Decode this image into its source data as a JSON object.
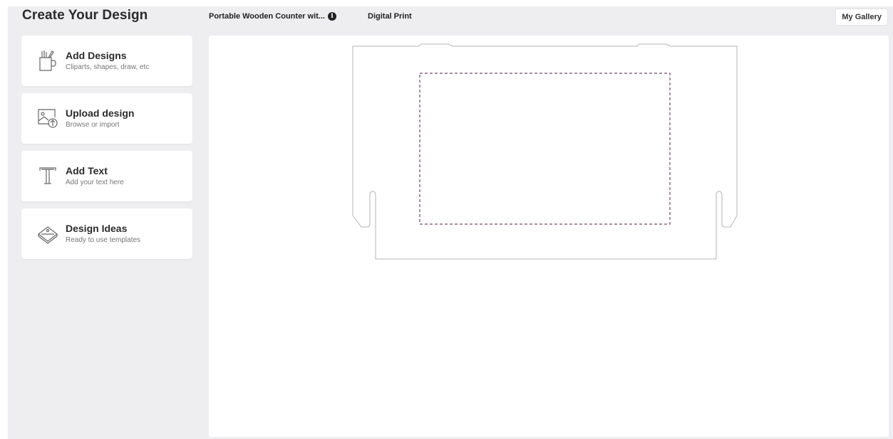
{
  "header": {
    "title": "Create Your Design",
    "product_name": "Portable Wooden Counter wit...",
    "info_icon_glyph": "i",
    "print_type": "Digital Print",
    "gallery_button": "My Gallery"
  },
  "tools": [
    {
      "title": "Add Designs",
      "subtitle": "Cliparts, shapes, draw, etc",
      "icon": "pencil-cup-icon"
    },
    {
      "title": "Upload design",
      "subtitle": "Browse or import",
      "icon": "upload-image-icon"
    },
    {
      "title": "Add Text",
      "subtitle": "Add your text here",
      "icon": "text-icon"
    },
    {
      "title": "Design Ideas",
      "subtitle": "Ready to use templates",
      "icon": "template-icon"
    }
  ],
  "colors": {
    "background": "#eeeef1",
    "panel": "#ffffff",
    "outline": "#b5b5b5",
    "print_area_dash": "#6e4a63"
  }
}
